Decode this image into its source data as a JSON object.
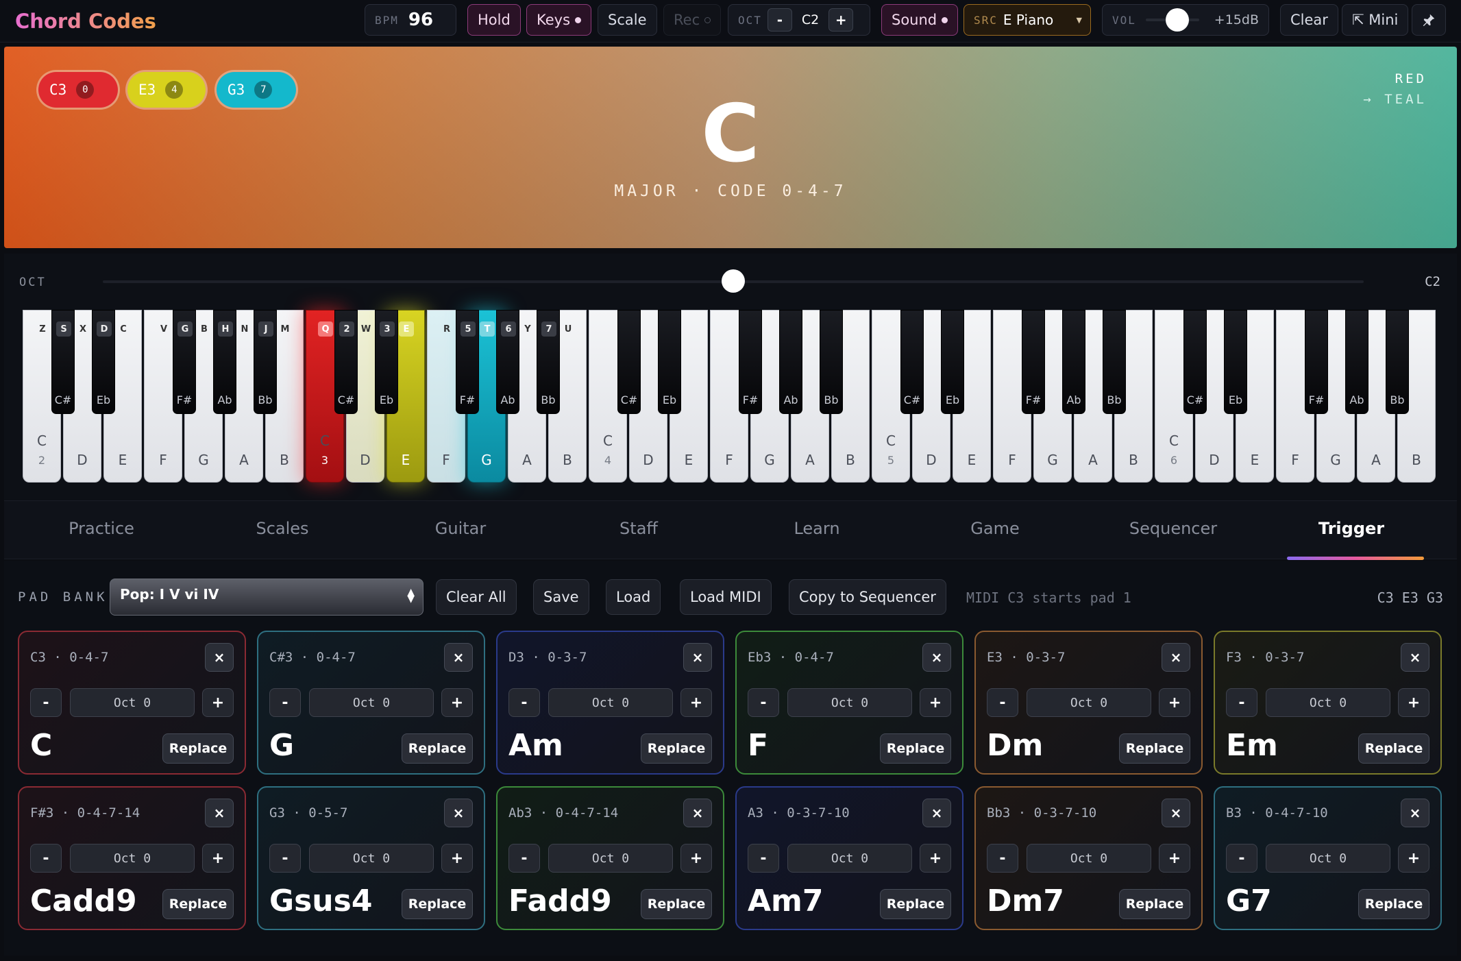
{
  "app": {
    "title": "Chord Codes"
  },
  "toolbar": {
    "bpm_label": "BPM",
    "bpm_value": "96",
    "hold": "Hold",
    "keys": "Keys",
    "scale": "Scale",
    "rec": "Rec",
    "oct_label": "OCT",
    "oct_minus": "-",
    "oct_value": "C2",
    "oct_plus": "+",
    "sound": "Sound",
    "src_label": "SRC",
    "src_value": "E Piano",
    "vol_label": "VOL",
    "vol_value": "+15dB",
    "vol_level": 0.55,
    "clear": "Clear",
    "mini": "⇱ Mini"
  },
  "hero": {
    "chord": "C",
    "subtitle": "MAJOR · CODE 0-4-7",
    "gradient_from": "RED",
    "gradient_to": "→ TEAL",
    "notes": [
      {
        "label": "C3",
        "num": "0",
        "color": "#e02a30"
      },
      {
        "label": "E3",
        "num": "4",
        "color": "#d8d11c"
      },
      {
        "label": "G3",
        "num": "7",
        "color": "#14b8cc"
      }
    ]
  },
  "octave": {
    "label": "OCT",
    "value": "C2",
    "level": 0.5
  },
  "keyboard": {
    "white_keys": [
      {
        "n": "C",
        "o": "2",
        "k": "Z"
      },
      {
        "n": "D",
        "k": "X"
      },
      {
        "n": "E",
        "k": "C"
      },
      {
        "n": "F",
        "k": "V"
      },
      {
        "n": "G",
        "k": "B"
      },
      {
        "n": "A",
        "k": "N"
      },
      {
        "n": "B",
        "k": "M"
      },
      {
        "n": "C",
        "o": "3",
        "k": "Q",
        "lit": "red"
      },
      {
        "n": "D",
        "k": "W"
      },
      {
        "n": "E",
        "k": "E",
        "lit": "yel"
      },
      {
        "n": "F",
        "k": "R"
      },
      {
        "n": "G",
        "k": "T",
        "lit": "teal"
      },
      {
        "n": "A",
        "k": "Y"
      },
      {
        "n": "B",
        "k": "U"
      },
      {
        "n": "C",
        "o": "4"
      },
      {
        "n": "D"
      },
      {
        "n": "E"
      },
      {
        "n": "F"
      },
      {
        "n": "G"
      },
      {
        "n": "A"
      },
      {
        "n": "B"
      },
      {
        "n": "C",
        "o": "5"
      },
      {
        "n": "D"
      },
      {
        "n": "E"
      },
      {
        "n": "F"
      },
      {
        "n": "G"
      },
      {
        "n": "A"
      },
      {
        "n": "B"
      },
      {
        "n": "C",
        "o": "6"
      },
      {
        "n": "D"
      },
      {
        "n": "E"
      },
      {
        "n": "F"
      },
      {
        "n": "G"
      },
      {
        "n": "A"
      },
      {
        "n": "B"
      }
    ],
    "black_keys": [
      {
        "n": "C#",
        "k": "S"
      },
      {
        "n": "Eb",
        "k": "D"
      },
      {
        "n": "F#",
        "k": "G"
      },
      {
        "n": "Ab",
        "k": "H"
      },
      {
        "n": "Bb",
        "k": "J"
      },
      {
        "n": "C#",
        "k": "2"
      },
      {
        "n": "Eb",
        "k": "3"
      },
      {
        "n": "F#",
        "k": "5"
      },
      {
        "n": "Ab",
        "k": "6"
      },
      {
        "n": "Bb",
        "k": "7"
      },
      {
        "n": "C#"
      },
      {
        "n": "Eb"
      },
      {
        "n": "F#"
      },
      {
        "n": "Ab"
      },
      {
        "n": "Bb"
      },
      {
        "n": "C#"
      },
      {
        "n": "Eb"
      },
      {
        "n": "F#"
      },
      {
        "n": "Ab"
      },
      {
        "n": "Bb"
      },
      {
        "n": "C#"
      },
      {
        "n": "Eb"
      },
      {
        "n": "F#"
      },
      {
        "n": "Ab"
      },
      {
        "n": "Bb"
      }
    ]
  },
  "tabs": [
    "Practice",
    "Scales",
    "Guitar",
    "Staff",
    "Learn",
    "Game",
    "Sequencer",
    "Trigger"
  ],
  "active_tab": "Trigger",
  "trigger": {
    "pad_bank_label": "PAD BANK",
    "pad_bank_value": "Pop: I V vi IV",
    "clear_all": "Clear All",
    "save": "Save",
    "load": "Load",
    "load_midi": "Load MIDI",
    "copy_to_sequencer": "Copy to Sequencer",
    "midi_note": "MIDI C3 starts pad 1",
    "active_notes": "C3 E3 G3",
    "pads": [
      {
        "hdr": "C3 · 0-4-7",
        "oct": "Oct 0",
        "name": "C",
        "color": "#8a2a33",
        "bg": "#1d1218"
      },
      {
        "hdr": "C#3 · 0-4-7",
        "oct": "Oct 0",
        "name": "G",
        "color": "#2e6f80",
        "bg": "#0f1c24"
      },
      {
        "hdr": "D3 · 0-3-7",
        "oct": "Oct 0",
        "name": "Am",
        "color": "#2a3a8a",
        "bg": "#11152a"
      },
      {
        "hdr": "Eb3 · 0-4-7",
        "oct": "Oct 0",
        "name": "F",
        "color": "#3c8a3a",
        "bg": "#111d16"
      },
      {
        "hdr": "E3 · 0-3-7",
        "oct": "Oct 0",
        "name": "Dm",
        "color": "#8a5a30",
        "bg": "#1d1714"
      },
      {
        "hdr": "F3 · 0-3-7",
        "oct": "Oct 0",
        "name": "Em",
        "color": "#7a7a2a",
        "bg": "#1a1b14"
      },
      {
        "hdr": "F#3 · 0-4-7-14",
        "oct": "Oct 0",
        "name": "Cadd9",
        "color": "#8a2a33",
        "bg": "#1d1218"
      },
      {
        "hdr": "G3 · 0-5-7",
        "oct": "Oct 0",
        "name": "Gsus4",
        "color": "#2e6f80",
        "bg": "#0f1c24"
      },
      {
        "hdr": "Ab3 · 0-4-7-14",
        "oct": "Oct 0",
        "name": "Fadd9",
        "color": "#3c8a3a",
        "bg": "#111d16"
      },
      {
        "hdr": "A3 · 0-3-7-10",
        "oct": "Oct 0",
        "name": "Am7",
        "color": "#2a3a8a",
        "bg": "#11152a"
      },
      {
        "hdr": "Bb3 · 0-3-7-10",
        "oct": "Oct 0",
        "name": "Dm7",
        "color": "#8a5a30",
        "bg": "#1d1714"
      },
      {
        "hdr": "B3 · 0-4-7-10",
        "oct": "Oct 0",
        "name": "G7",
        "color": "#2e6f80",
        "bg": "#0f1c24"
      }
    ],
    "pad_labels": {
      "close": "×",
      "minus": "-",
      "plus": "+",
      "replace": "Replace"
    }
  }
}
